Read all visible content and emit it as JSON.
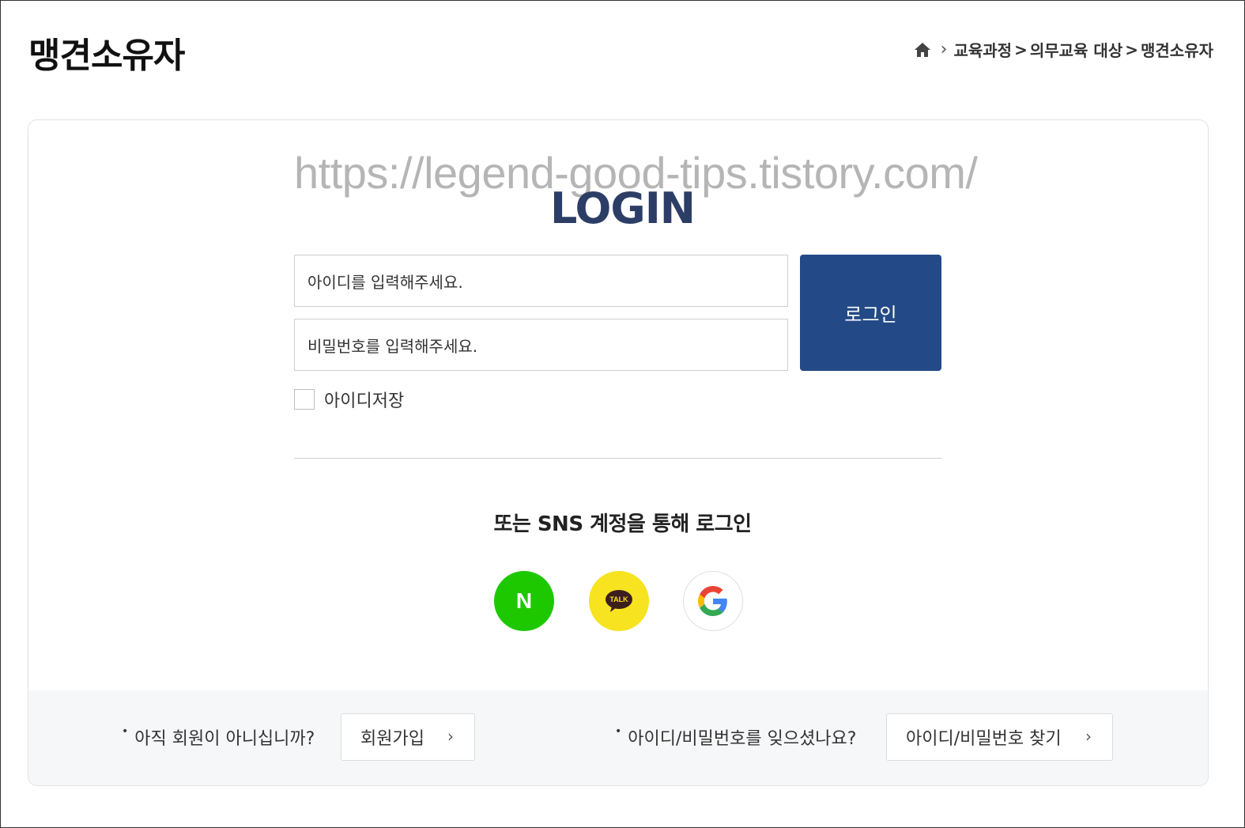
{
  "page": {
    "title": "맹견소유자",
    "watermark": "https://legend-good-tips.tistory.com/"
  },
  "breadcrumb": {
    "home_icon": "home-icon",
    "items": [
      "교육과정",
      "의무교육 대상",
      "맹견소유자"
    ],
    "separator": ">"
  },
  "login": {
    "title": "LOGIN",
    "id_placeholder": "아이디를 입력해주세요.",
    "pw_placeholder": "비밀번호를 입력해주세요.",
    "submit_label": "로그인",
    "save_id_label": "아이디저장",
    "save_id_checked": false
  },
  "sns": {
    "title": "또는 SNS 계정을 통해 로그인",
    "providers": [
      {
        "name": "naver",
        "icon": "naver-icon",
        "glyph": "N",
        "color": "#1ec800"
      },
      {
        "name": "kakao",
        "icon": "kakao-talk-icon",
        "glyph": "TALK",
        "color": "#f7e31f"
      },
      {
        "name": "google",
        "icon": "google-icon",
        "color": "#ffffff"
      }
    ]
  },
  "footer": {
    "join_question": "아직 회원이 아니십니까?",
    "join_button": "회원가입",
    "find_question": "아이디/비밀번호를 잊으셨나요?",
    "find_button": "아이디/비밀번호 찾기"
  },
  "colors": {
    "primary": "#234a87",
    "title": "#2c3e66",
    "naver": "#1ec800",
    "kakao": "#f7e31f"
  }
}
